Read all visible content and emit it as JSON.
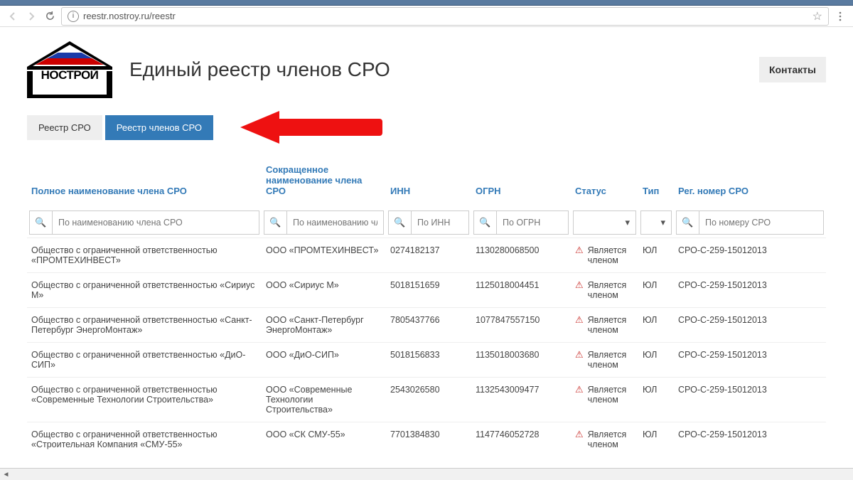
{
  "browser": {
    "url": "reestr.nostroy.ru/reestr"
  },
  "header": {
    "logo_text": "НОСТРОЙ",
    "title": "Единый реестр членов СРО",
    "contacts_btn": "Контакты"
  },
  "tabs": {
    "tab1": "Реестр СРО",
    "tab2": "Реестр членов СРО"
  },
  "columns": {
    "full_name": "Полное наименование члена СРО",
    "short_name": "Сокращенное наименование члена СРО",
    "inn": "ИНН",
    "ogrn": "ОГРН",
    "status": "Статус",
    "type": "Тип",
    "reg_num": "Рег. номер СРО"
  },
  "filters": {
    "full_name_ph": "По наименованию члена СРО",
    "short_name_ph": "По наименованию члена",
    "inn_ph": "По ИНН",
    "ogrn_ph": "По ОГРН",
    "reg_num_ph": "По номеру СРО"
  },
  "rows": [
    {
      "full_name": "Общество с ограниченной ответственностью «ПРОМТЕХИНВЕСТ»",
      "short_name": "ООО «ПРОМТЕХИНВЕСТ»",
      "inn": "0274182137",
      "ogrn": "1130280068500",
      "status": "Является членом",
      "type": "ЮЛ",
      "reg_num": "СРО-С-259-15012013"
    },
    {
      "full_name": "Общество с ограниченной ответственностью «Сириус М»",
      "short_name": "ООО «Сириус М»",
      "inn": "5018151659",
      "ogrn": "1125018004451",
      "status": "Является членом",
      "type": "ЮЛ",
      "reg_num": "СРО-С-259-15012013"
    },
    {
      "full_name": "Общество с ограниченной ответственностью «Санкт-Петербург ЭнергоМонтаж»",
      "short_name": "ООО «Санкт-Петербург ЭнергоМонтаж»",
      "inn": "7805437766",
      "ogrn": "1077847557150",
      "status": "Является членом",
      "type": "ЮЛ",
      "reg_num": "СРО-С-259-15012013"
    },
    {
      "full_name": "Общество с ограниченной ответственностью «ДиО-СИП»",
      "short_name": "ООО «ДиО-СИП»",
      "inn": "5018156833",
      "ogrn": "1135018003680",
      "status": "Является членом",
      "type": "ЮЛ",
      "reg_num": "СРО-С-259-15012013"
    },
    {
      "full_name": "Общество с ограниченной ответственностью «Современные Технологии Строительства»",
      "short_name": "ООО «Современные Технологии Строительства»",
      "inn": "2543026580",
      "ogrn": "1132543009477",
      "status": "Является членом",
      "type": "ЮЛ",
      "reg_num": "СРО-С-259-15012013"
    },
    {
      "full_name": "Общество с ограниченной ответственностью «Строительная Компания «СМУ-55»",
      "short_name": "ООО «СК СМУ-55»",
      "inn": "7701384830",
      "ogrn": "1147746052728",
      "status": "Является членом",
      "type": "ЮЛ",
      "reg_num": "СРО-С-259-15012013"
    }
  ]
}
